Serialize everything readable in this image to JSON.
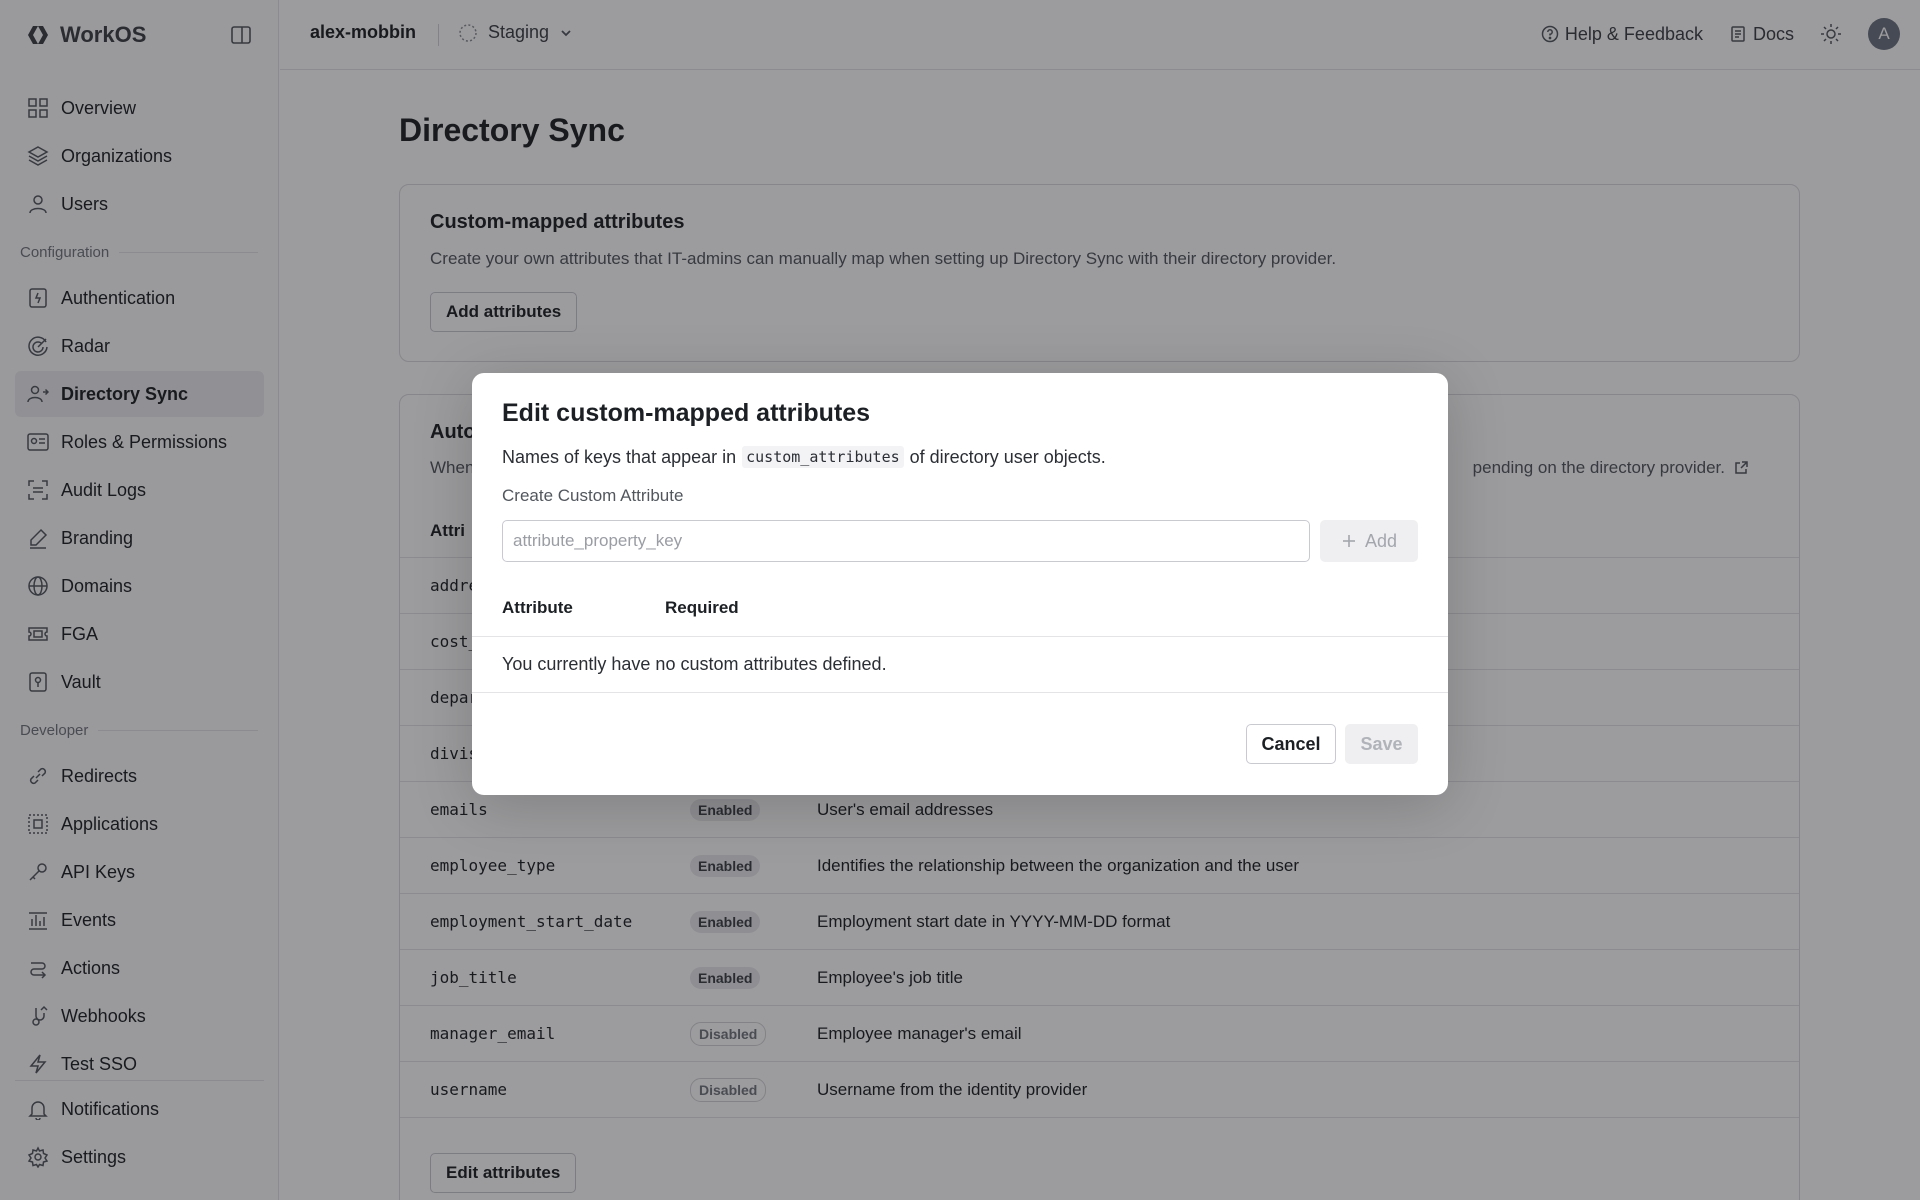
{
  "app": {
    "brand": "WorkOS"
  },
  "topbar": {
    "org": "alex-mobbin",
    "environment": "Staging",
    "help": "Help & Feedback",
    "docs": "Docs",
    "avatar_initial": "A"
  },
  "sidebar": {
    "items_top": [
      {
        "label": "Overview",
        "icon": "grid-icon"
      },
      {
        "label": "Organizations",
        "icon": "layers-icon"
      },
      {
        "label": "Users",
        "icon": "user-icon"
      }
    ],
    "section_config": "Configuration",
    "items_config": [
      {
        "label": "Authentication",
        "icon": "auth-icon"
      },
      {
        "label": "Radar",
        "icon": "radar-icon"
      },
      {
        "label": "Directory Sync",
        "icon": "users-sync-icon",
        "active": true
      },
      {
        "label": "Roles & Permissions",
        "icon": "id-card-icon"
      },
      {
        "label": "Audit Logs",
        "icon": "scan-icon"
      },
      {
        "label": "Branding",
        "icon": "brush-icon"
      },
      {
        "label": "Domains",
        "icon": "globe-icon"
      },
      {
        "label": "FGA",
        "icon": "ticket-icon"
      },
      {
        "label": "Vault",
        "icon": "vault-icon"
      }
    ],
    "section_dev": "Developer",
    "items_dev": [
      {
        "label": "Redirects",
        "icon": "link-icon"
      },
      {
        "label": "Applications",
        "icon": "app-icon"
      },
      {
        "label": "API Keys",
        "icon": "key-icon"
      },
      {
        "label": "Events",
        "icon": "events-icon"
      },
      {
        "label": "Actions",
        "icon": "actions-icon"
      },
      {
        "label": "Webhooks",
        "icon": "webhook-icon"
      },
      {
        "label": "Test SSO",
        "icon": "bolt-icon"
      }
    ],
    "items_bottom": [
      {
        "label": "Notifications",
        "icon": "bell-icon"
      },
      {
        "label": "Settings",
        "icon": "gear-icon"
      }
    ]
  },
  "main": {
    "title": "Directory Sync",
    "custom_card": {
      "title": "Custom-mapped attributes",
      "desc": "Create your own attributes that IT-admins can manually map when setting up Directory Sync with their directory provider.",
      "button": "Add attributes"
    },
    "auto_card": {
      "title_partial": "Auto",
      "desc_left_partial": "When",
      "desc_right_partial": "pending on the directory provider.",
      "col_header_partial": "Attri",
      "rows": [
        {
          "attr": "addre",
          "status": "",
          "desc": ""
        },
        {
          "attr": "cost_",
          "status": "",
          "desc": ""
        },
        {
          "attr": "depar",
          "status": "",
          "desc": ""
        },
        {
          "attr": "divis",
          "status": "",
          "desc": ""
        },
        {
          "attr": "emails",
          "status": "Enabled",
          "desc": "User's email addresses"
        },
        {
          "attr": "employee_type",
          "status": "Enabled",
          "desc": "Identifies the relationship between the organization and the user"
        },
        {
          "attr": "employment_start_date",
          "status": "Enabled",
          "desc": "Employment start date in YYYY-MM-DD format"
        },
        {
          "attr": "job_title",
          "status": "Enabled",
          "desc": "Employee's job title"
        },
        {
          "attr": "manager_email",
          "status": "Disabled",
          "desc": "Employee manager's email"
        },
        {
          "attr": "username",
          "status": "Disabled",
          "desc": "Username from the identity provider"
        }
      ],
      "button": "Edit attributes"
    }
  },
  "modal": {
    "title": "Edit custom-mapped attributes",
    "desc_before": "Names of keys that appear in",
    "desc_code": "custom_attributes",
    "desc_after": "of directory user objects.",
    "label": "Create Custom Attribute",
    "placeholder": "attribute_property_key",
    "add_label": "Add",
    "col_attribute": "Attribute",
    "col_required": "Required",
    "empty": "You currently have no custom attributes defined.",
    "cancel": "Cancel",
    "save": "Save"
  }
}
